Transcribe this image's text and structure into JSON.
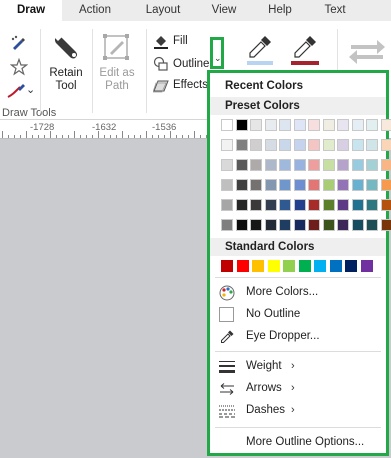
{
  "tabs": [
    {
      "label": "Draw",
      "active": true
    },
    {
      "label": "Action",
      "active": false
    },
    {
      "label": "Layout",
      "active": false
    },
    {
      "label": "View",
      "active": false
    },
    {
      "label": "Help",
      "active": false
    },
    {
      "label": "Text",
      "active": false
    }
  ],
  "ribbon": {
    "draw_tools_group": "Draw Tools",
    "retain_tool": "Retain Tool",
    "edit_as_path": "Edit as Path",
    "fill": "Fill",
    "outline": "Outline",
    "effects": "Effects"
  },
  "ruler": {
    "labels": [
      "-1728",
      "-1632",
      "-1536"
    ]
  },
  "dropdown": {
    "recent_colors": "Recent Colors",
    "preset_colors": "Preset Colors",
    "standard_colors": "Standard Colors",
    "more_colors": "More Colors...",
    "no_outline": "No Outline",
    "eye_dropper": "Eye Dropper...",
    "weight": "Weight",
    "arrows": "Arrows",
    "dashes": "Dashes",
    "more_outline_options": "More Outline Options...",
    "preset_grid": [
      [
        "#ffffff",
        "#000000",
        "#e7e6e6",
        "#e8ebf0",
        "#dde5f0",
        "#dee5f6",
        "#f8dfdf",
        "#f0eee2",
        "#e9e5f0",
        "#e5eef4",
        "#e2eff0",
        "#f9e8dc"
      ],
      [
        "#f2f2f2",
        "#7f7f7f",
        "#d0cece",
        "#d5dce4",
        "#c8d7ea",
        "#c5d3ee",
        "#f5c5c4",
        "#e1eccd",
        "#d8cfe4",
        "#c8e4ef",
        "#cfe5e8",
        "#fbd5b8"
      ],
      [
        "#d9d9d9",
        "#595959",
        "#aeaaaa",
        "#adb9ca",
        "#9fb9dc",
        "#99b3e0",
        "#ee9e9c",
        "#c8dfa3",
        "#b5a3cc",
        "#97cbe0",
        "#a3d1d6",
        "#f8b585"
      ],
      [
        "#bfbfbf",
        "#404040",
        "#767171",
        "#8497b0",
        "#6f97cc",
        "#6d8fd1",
        "#e37674",
        "#a9cd77",
        "#9373b6",
        "#69b1d0",
        "#74b9c1",
        "#f59a4f"
      ],
      [
        "#a6a6a6",
        "#262626",
        "#3a3838",
        "#333f50",
        "#2e5a91",
        "#23408f",
        "#a72c29",
        "#5c7f2c",
        "#5c3a86",
        "#217290",
        "#2d7780",
        "#b4520d"
      ],
      [
        "#7f7f7f",
        "#0d0d0d",
        "#171616",
        "#222a35",
        "#1f3d60",
        "#172a5f",
        "#6f1d1b",
        "#3d551d",
        "#3d2759",
        "#164c60",
        "#1e4f56",
        "#783609"
      ]
    ],
    "standard_row": [
      "#c00000",
      "#ff0000",
      "#ffc000",
      "#ffff00",
      "#92d050",
      "#00b050",
      "#00b0f0",
      "#0070c0",
      "#002060",
      "#7030a0"
    ]
  }
}
